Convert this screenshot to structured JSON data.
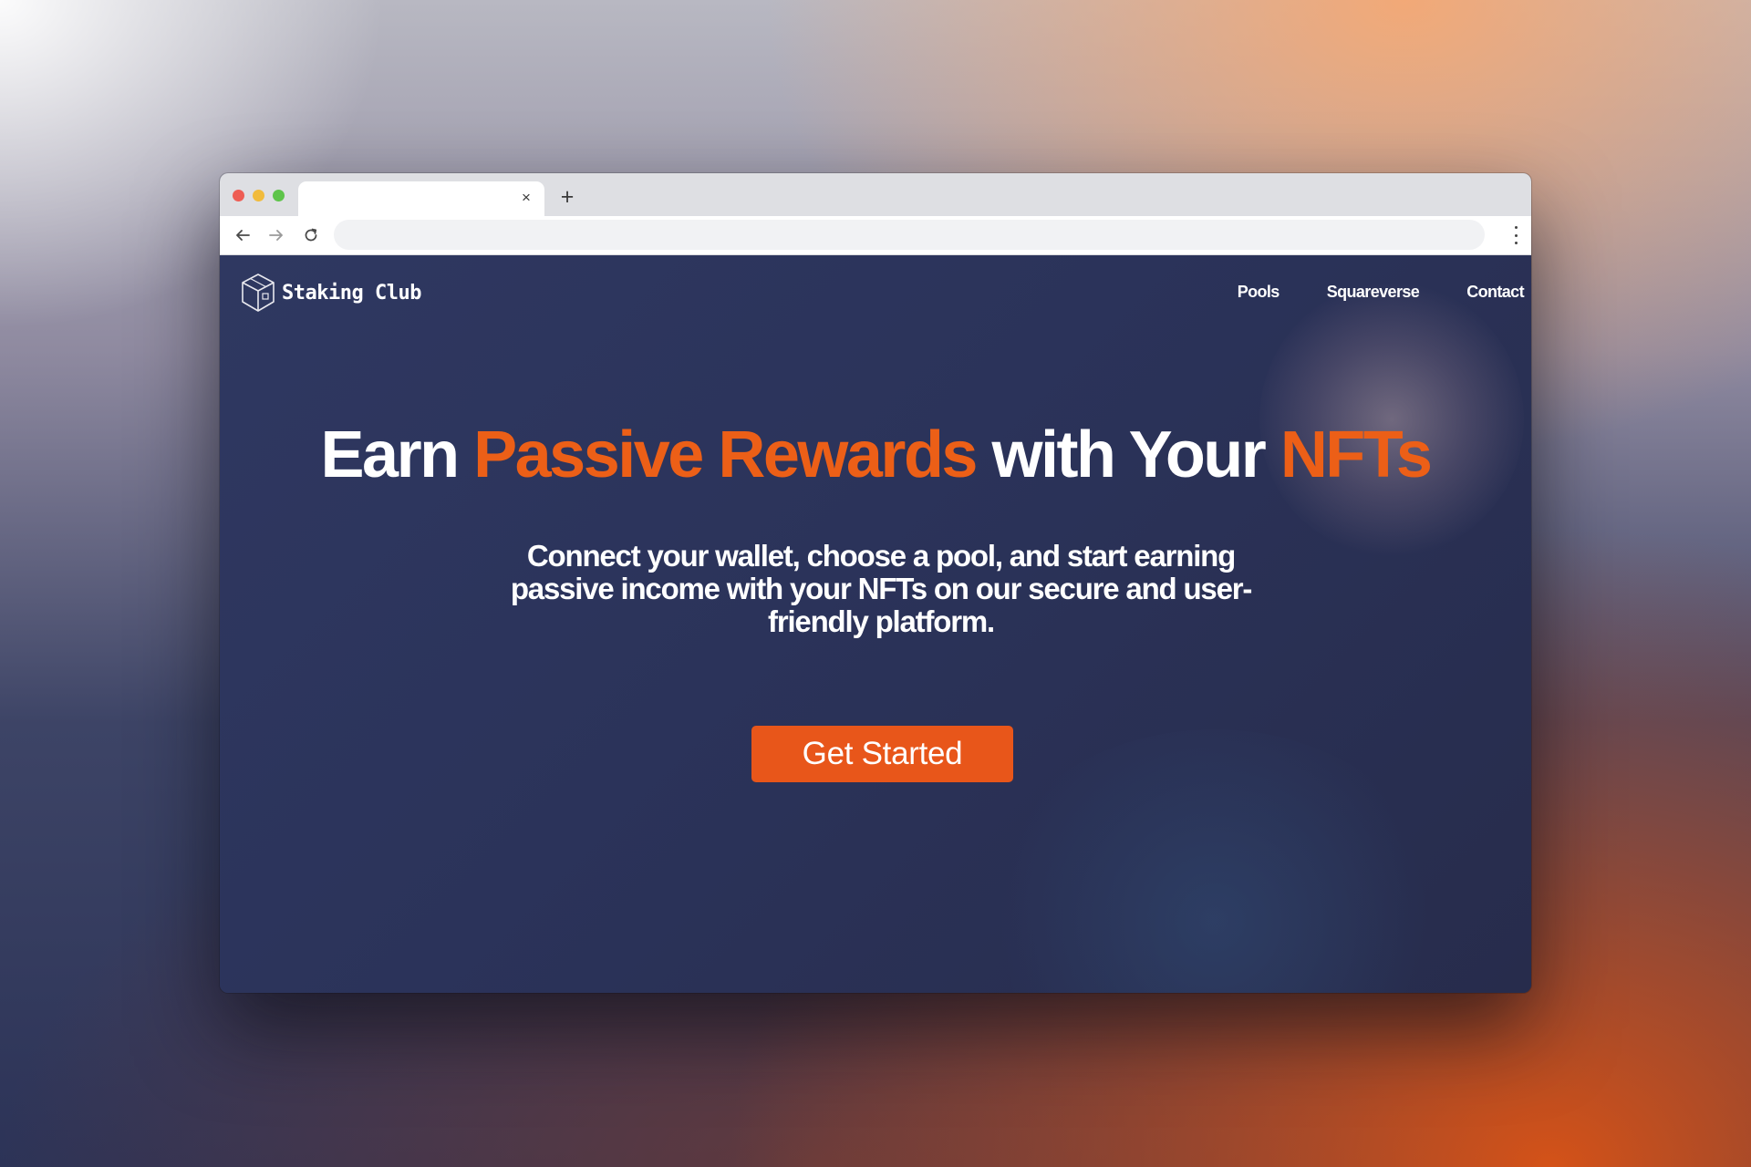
{
  "browser": {
    "tab_close_glyph": "×",
    "new_tab_glyph": "+",
    "icons": [
      "close-dot",
      "minimize-dot",
      "maximize-dot",
      "back-arrow-icon",
      "forward-arrow-icon",
      "reload-icon",
      "kebab-menu-icon"
    ]
  },
  "site": {
    "brand": "Staking Club",
    "nav": [
      "Pools",
      "Squareverse",
      "Contact"
    ],
    "hero": {
      "title_parts": [
        "Earn ",
        "Passive Rewards",
        " with Your ",
        "NFTs"
      ],
      "subtitle": "Connect your wallet, choose a pool, and start earning passive income with your NFTs on our secure and user-friendly platform.",
      "cta": "Get Started"
    },
    "colors": {
      "accent": "#ec5f17",
      "button": "#e8561a",
      "background": "#2b335a"
    }
  }
}
